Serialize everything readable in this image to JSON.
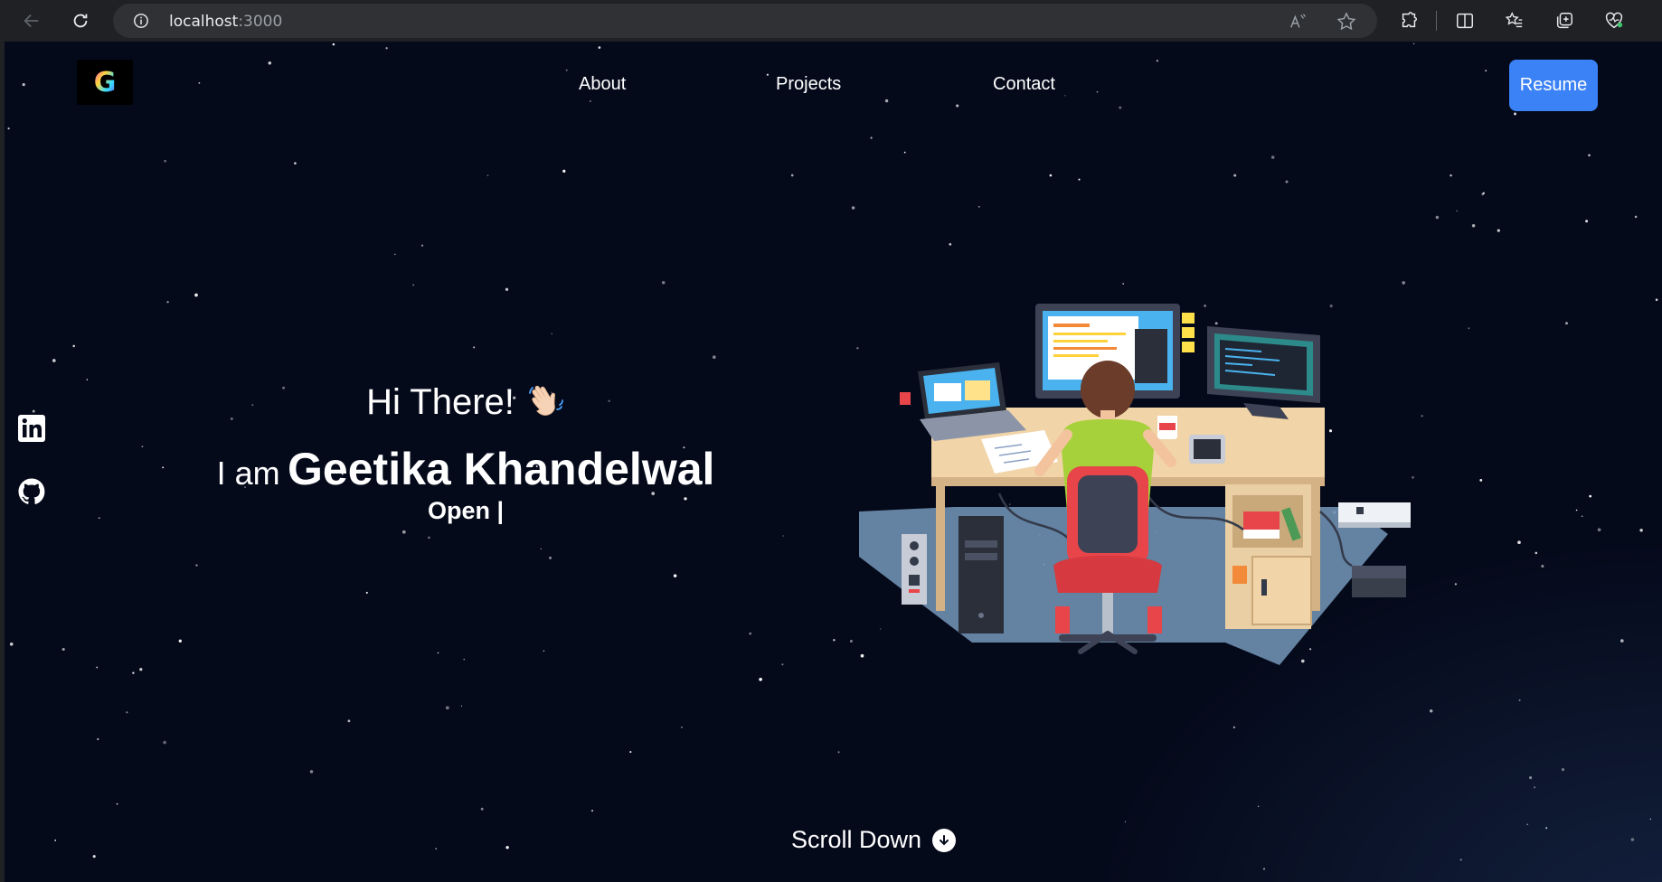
{
  "browser": {
    "url_host": "localhost",
    "url_port": ":3000"
  },
  "nav": {
    "links": [
      "About",
      "Projects",
      "Contact"
    ],
    "resume_label": "Resume",
    "logo_letter": "G"
  },
  "hero": {
    "greeting": "Hi There!",
    "greeting_emoji": "waving-hand",
    "intro_prefix": "I am",
    "name": "Geetika Khandelwal",
    "typed_text": "Open |"
  },
  "social": [
    "linkedin-icon",
    "github-icon"
  ],
  "scroll": {
    "label": "Scroll Down"
  },
  "colors": {
    "background": "#050a1b",
    "accent": "#3b82f6",
    "text": "#ffffff"
  }
}
